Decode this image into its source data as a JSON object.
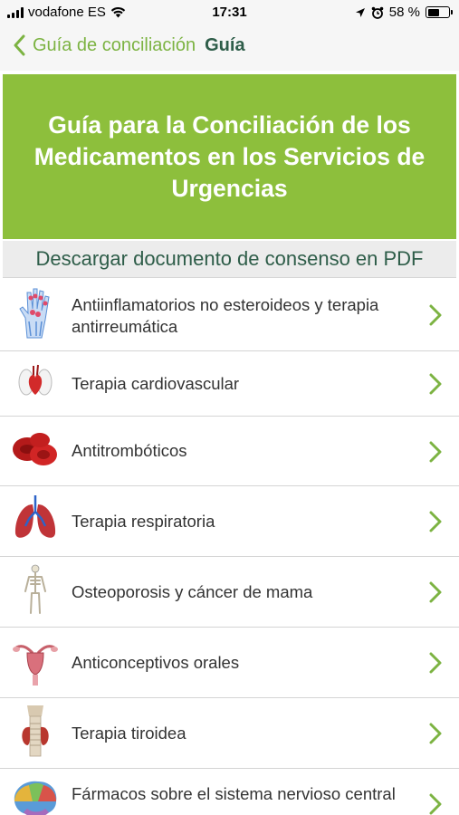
{
  "status_bar": {
    "carrier": "vodafone ES",
    "time": "17:31",
    "battery_percent": "58 %",
    "battery_level": 0.58
  },
  "nav": {
    "back_label": "Guía de conciliación",
    "title": "Guía"
  },
  "banner": {
    "title": "Guía para la Conciliación de los Medicamentos en los Servicios de Urgencias"
  },
  "download": {
    "label": "Descargar documento de consenso en PDF"
  },
  "colors": {
    "accent_green": "#8dbf3c",
    "link_green": "#7cb342",
    "dark_green": "#2e5d49"
  },
  "list": {
    "items": [
      {
        "label": "Antiinflamatorios no esteroideos y terapia antirreumática",
        "icon": "hand-joints-icon"
      },
      {
        "label": "Terapia cardiovascular",
        "icon": "heart-icon"
      },
      {
        "label": "Antitrombóticos",
        "icon": "red-blood-cells-icon"
      },
      {
        "label": "Terapia respiratoria",
        "icon": "lungs-icon"
      },
      {
        "label": "Osteoporosis y cáncer de mama",
        "icon": "skeleton-icon"
      },
      {
        "label": "Anticonceptivos orales",
        "icon": "uterus-icon"
      },
      {
        "label": "Terapia tiroidea",
        "icon": "thyroid-icon"
      },
      {
        "label": "Fármacos sobre el sistema nervioso central",
        "icon": "brain-icon"
      }
    ]
  }
}
